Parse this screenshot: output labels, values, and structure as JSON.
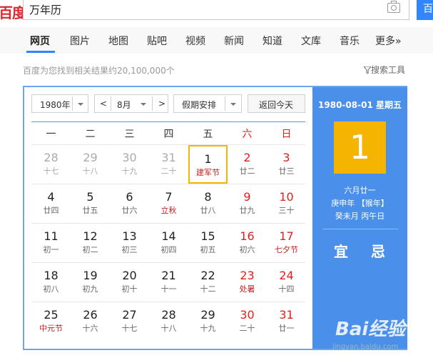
{
  "header": {
    "logo": "百度",
    "query": "万年历",
    "search_btn": "百"
  },
  "nav": {
    "items": [
      "网页",
      "图片",
      "地图",
      "贴吧",
      "视频",
      "新闻",
      "知道",
      "文库",
      "音乐",
      "更多»"
    ]
  },
  "results": {
    "count_text": "百度为您找到相关结果约20,100,000个",
    "tools_label": "搜索工具"
  },
  "calendar": {
    "year_select": "1980年",
    "month_select": "8月",
    "holiday_select": "假期安排",
    "today_button": "返回今天",
    "prev_arrow": "<",
    "next_arrow": ">",
    "weekdays": [
      "一",
      "二",
      "三",
      "四",
      "五",
      "六",
      "日"
    ],
    "weeks": [
      [
        {
          "d": "28",
          "l": "十七",
          "o": true
        },
        {
          "d": "29",
          "l": "十八",
          "o": true
        },
        {
          "d": "30",
          "l": "十九",
          "o": true
        },
        {
          "d": "31",
          "l": "二十",
          "o": true
        },
        {
          "d": "1",
          "l": "建军节",
          "f": true,
          "t": true
        },
        {
          "d": "2",
          "l": "廿二"
        },
        {
          "d": "3",
          "l": "廿三"
        }
      ],
      [
        {
          "d": "4",
          "l": "廿四"
        },
        {
          "d": "5",
          "l": "廿五"
        },
        {
          "d": "6",
          "l": "廿六"
        },
        {
          "d": "7",
          "l": "立秋",
          "f": true
        },
        {
          "d": "8",
          "l": "廿八"
        },
        {
          "d": "9",
          "l": "廿九"
        },
        {
          "d": "10",
          "l": "三十"
        }
      ],
      [
        {
          "d": "11",
          "l": "初一"
        },
        {
          "d": "12",
          "l": "初二"
        },
        {
          "d": "13",
          "l": "初三"
        },
        {
          "d": "14",
          "l": "初四"
        },
        {
          "d": "15",
          "l": "初五"
        },
        {
          "d": "16",
          "l": "初六"
        },
        {
          "d": "17",
          "l": "七夕节",
          "f": true
        }
      ],
      [
        {
          "d": "18",
          "l": "初八"
        },
        {
          "d": "19",
          "l": "初九"
        },
        {
          "d": "20",
          "l": "初十"
        },
        {
          "d": "21",
          "l": "十一"
        },
        {
          "d": "22",
          "l": "十二"
        },
        {
          "d": "23",
          "l": "处暑",
          "f": true
        },
        {
          "d": "24",
          "l": "十四"
        }
      ],
      [
        {
          "d": "25",
          "l": "中元节",
          "f": true
        },
        {
          "d": "26",
          "l": "十六"
        },
        {
          "d": "27",
          "l": "十七"
        },
        {
          "d": "28",
          "l": "十八"
        },
        {
          "d": "29",
          "l": "十九"
        },
        {
          "d": "30",
          "l": "二十"
        },
        {
          "d": "31",
          "l": "廿一"
        }
      ]
    ],
    "side": {
      "date_line": "1980-08-01 星期五",
      "big_day": "1",
      "lunar_date": "六月廿一",
      "ganzhi_year": "庚申年 【猴年】",
      "ganzhi_month_day": "癸未月 丙午日",
      "yi": "宜",
      "ji": "忌"
    }
  },
  "watermark": {
    "text": "Bai经验",
    "url": "jingyan.baidu.com"
  }
}
